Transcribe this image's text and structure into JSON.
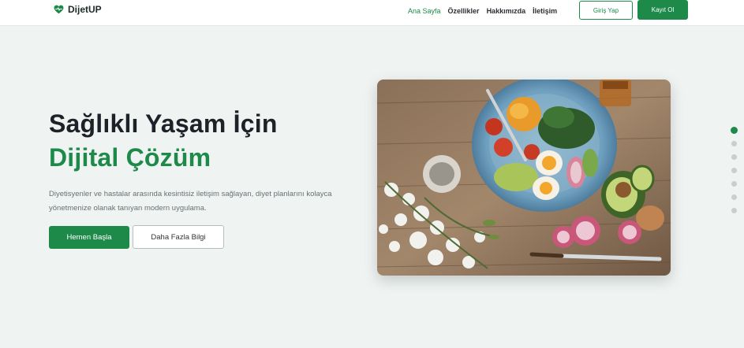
{
  "brand": {
    "name": "DijetUP",
    "icon": "heart-pulse-icon",
    "color": "#1e8a4a"
  },
  "nav": {
    "links": [
      {
        "label": "Ana Sayfa",
        "active": true
      },
      {
        "label": "Özellikler",
        "active": false
      },
      {
        "label": "Hakkımızda",
        "active": false
      },
      {
        "label": "İletişim",
        "active": false
      }
    ],
    "login_label": "Giriş Yap",
    "register_label": "Kayıt Ol"
  },
  "hero": {
    "title_line1": "Sağlıklı Yaşam İçin",
    "title_line2": "Dijital Çözüm",
    "description": "Diyetisyenler ve hastalar arasında kesintisiz iletişim sağlayan, diyet planlarını kolayca yönetmenize olanak tanıyan modern uygulama.",
    "primary_button": "Hemen Başla",
    "secondary_button": "Daha Fazla Bilgi"
  },
  "section_dots": {
    "count": 7,
    "active_index": 0
  },
  "colors": {
    "accent": "#1e8a4a",
    "background": "#eff4f3",
    "text": "#1e2228"
  }
}
